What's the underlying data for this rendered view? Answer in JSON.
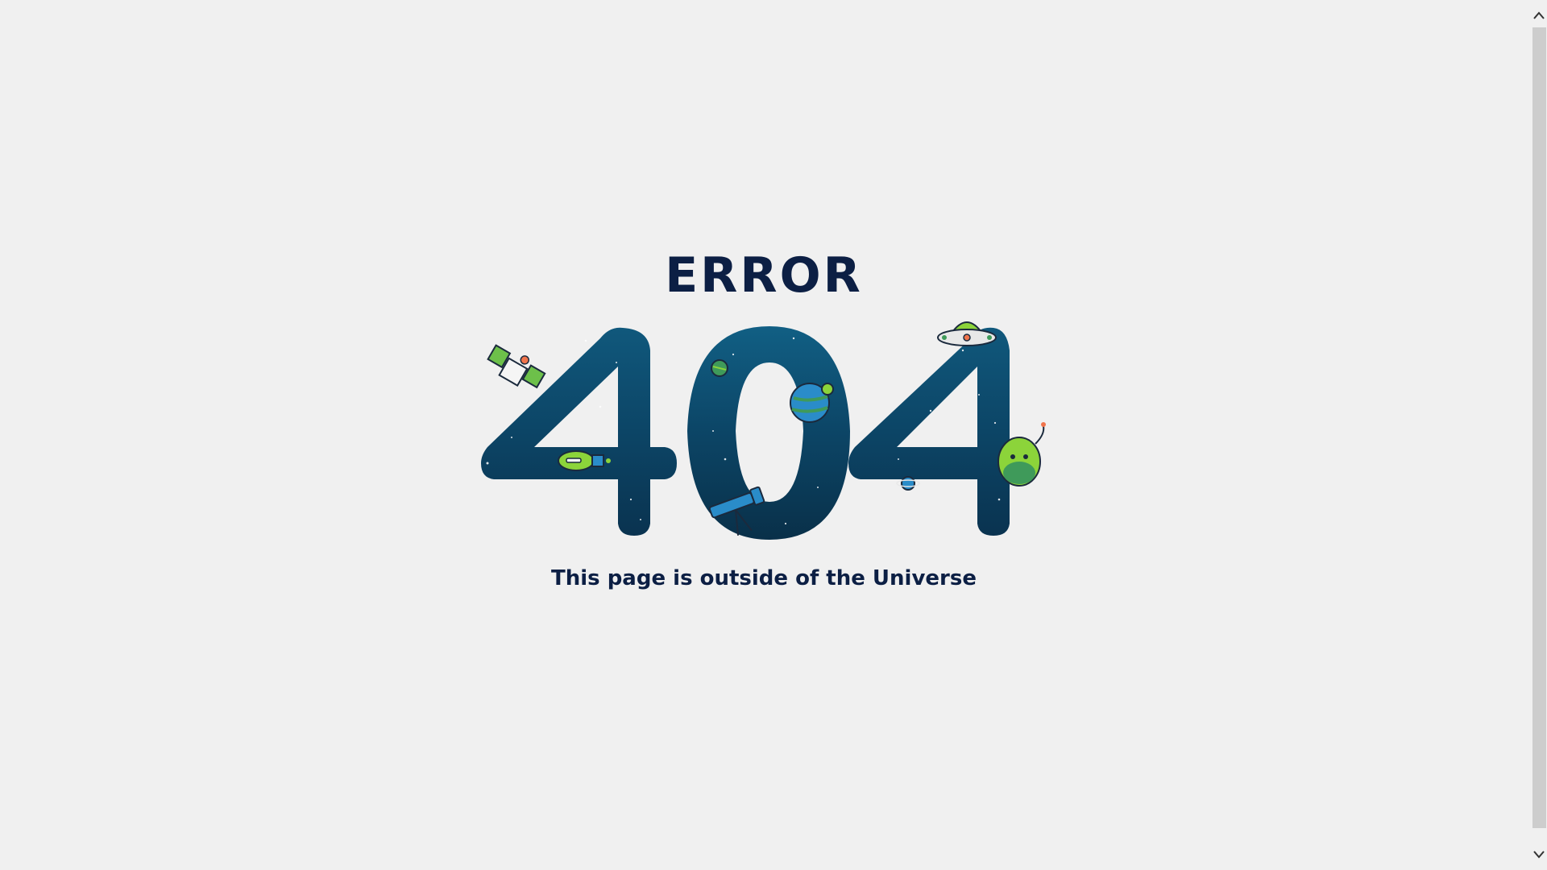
{
  "error": {
    "heading": "ERROR",
    "code": [
      "4",
      "0",
      "4"
    ],
    "message": "This page is outside of the Universe"
  },
  "colors": {
    "background": "#f0f0f0",
    "text": "#0c1f44",
    "digit_dark": "#0a3350",
    "digit_light": "#0f5a7e",
    "accent_green": "#8cd43a",
    "accent_blue": "#2a8cc9",
    "scrollbar_thumb": "#cdcdcd"
  },
  "icons": [
    "satellite-icon",
    "rocket-icon",
    "planet-icon",
    "small-planet-icon",
    "telescope-icon",
    "ufo-icon",
    "alien-icon",
    "ringed-planet-icon",
    "scroll-up-arrow-icon",
    "scroll-down-arrow-icon"
  ]
}
